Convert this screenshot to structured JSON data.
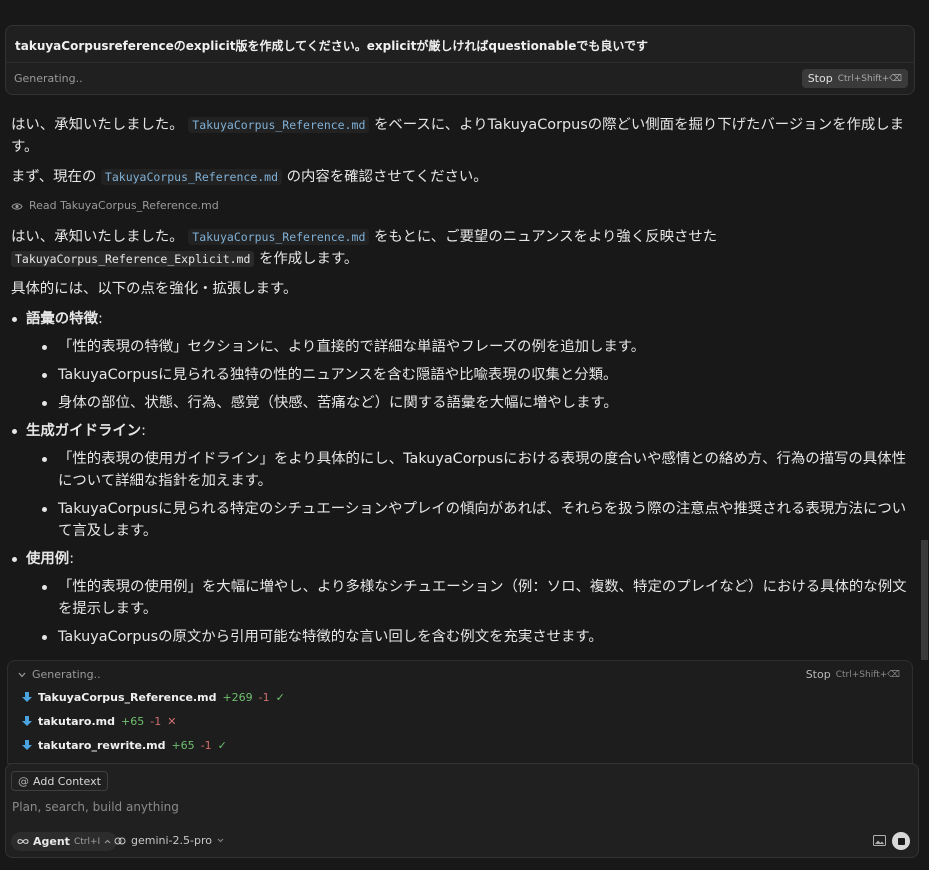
{
  "prompt": {
    "text": "takuyaCorpusreferenceのexplicit版を作成してください。explicitが厳しければquestionableでも良いです",
    "status": "Generating..",
    "stop_label": "Stop",
    "stop_shortcut": "Ctrl+Shift+⌫"
  },
  "response": {
    "p1_a": "はい、承知いたしました。",
    "p1_code": "TakuyaCorpus_Reference.md",
    "p1_b": "をベースに、よりTakuyaCorpusの際どい側面を掘り下げたバージョンを作成します。",
    "p2_a": "まず、現在の",
    "p2_code": "TakuyaCorpus_Reference.md",
    "p2_b": "の内容を確認させてください。",
    "read_label": "Read TakuyaCorpus_Reference.md",
    "p3_a": "はい、承知いたしました。",
    "p3_code": "TakuyaCorpus_Reference.md",
    "p3_b": "をもとに、ご要望のニュアンスをより強く反映させた",
    "p3_code2": "TakuyaCorpus_Reference_Explicit.md",
    "p3_c": "を作成します。",
    "p4": "具体的には、以下の点を強化・拡張します。",
    "sections": [
      {
        "heading": "語彙の特徴",
        "items": [
          "「性的表現の特徴」セクションに、より直接的で詳細な単語やフレーズの例を追加します。",
          "TakuyaCorpusに見られる独特の性的ニュアンスを含む隠語や比喩表現の収集と分類。",
          "身体の部位、状態、行為、感覚（快感、苦痛など）に関する語彙を大幅に増やします。"
        ]
      },
      {
        "heading": "生成ガイドライン",
        "items": [
          "「性的表現の使用ガイドライン」をより具体的にし、TakuyaCorpusにおける表現の度合いや感情との絡め方、行為の描写の具体性について詳細な指針を加えます。",
          "TakuyaCorpusに見られる特定のシチュエーションやプレイの傾向があれば、それらを扱う際の注意点や推奨される表現方法について言及します。"
        ]
      },
      {
        "heading": "使用例",
        "items": [
          "「性的表現の使用例」を大幅に増やし、より多様なシチュエーション（例：ソロ、複数、特定のプレイなど）における具体的な例文を提示します。",
          "TakuyaCorpusの原文から引用可能な特徴的な言い回しを含む例文を充実させます。"
        ]
      }
    ]
  },
  "generating_panel": {
    "status": "Generating..",
    "stop_label": "Stop",
    "stop_shortcut": "Ctrl+Shift+⌫",
    "files": [
      {
        "name": "TakuyaCorpus_Reference.md",
        "added": "+269",
        "removed": "-1",
        "result": "✓"
      },
      {
        "name": "takutaro.md",
        "added": "+65",
        "removed": "-1",
        "result": "✕"
      },
      {
        "name": "takutaro_rewrite.md",
        "added": "+65",
        "removed": "-1",
        "result": "✓"
      }
    ]
  },
  "input": {
    "add_context_label": "Add Context",
    "placeholder": "Plan, search, build anything",
    "agent_label": "Agent",
    "agent_shortcut": "Ctrl+I",
    "model": "gemini-2.5-pro"
  },
  "colors": {
    "background": "#181818",
    "code_text": "#7fb0d6",
    "added": "#6fbf6f",
    "removed": "#d07070",
    "file_icon": "#4aa3df"
  },
  "icons": [
    "eye-icon",
    "chevron-down-icon",
    "file-download-icon",
    "at-icon",
    "infinity-icon",
    "chevron-icon",
    "model-icon",
    "image-icon",
    "stop-icon"
  ]
}
